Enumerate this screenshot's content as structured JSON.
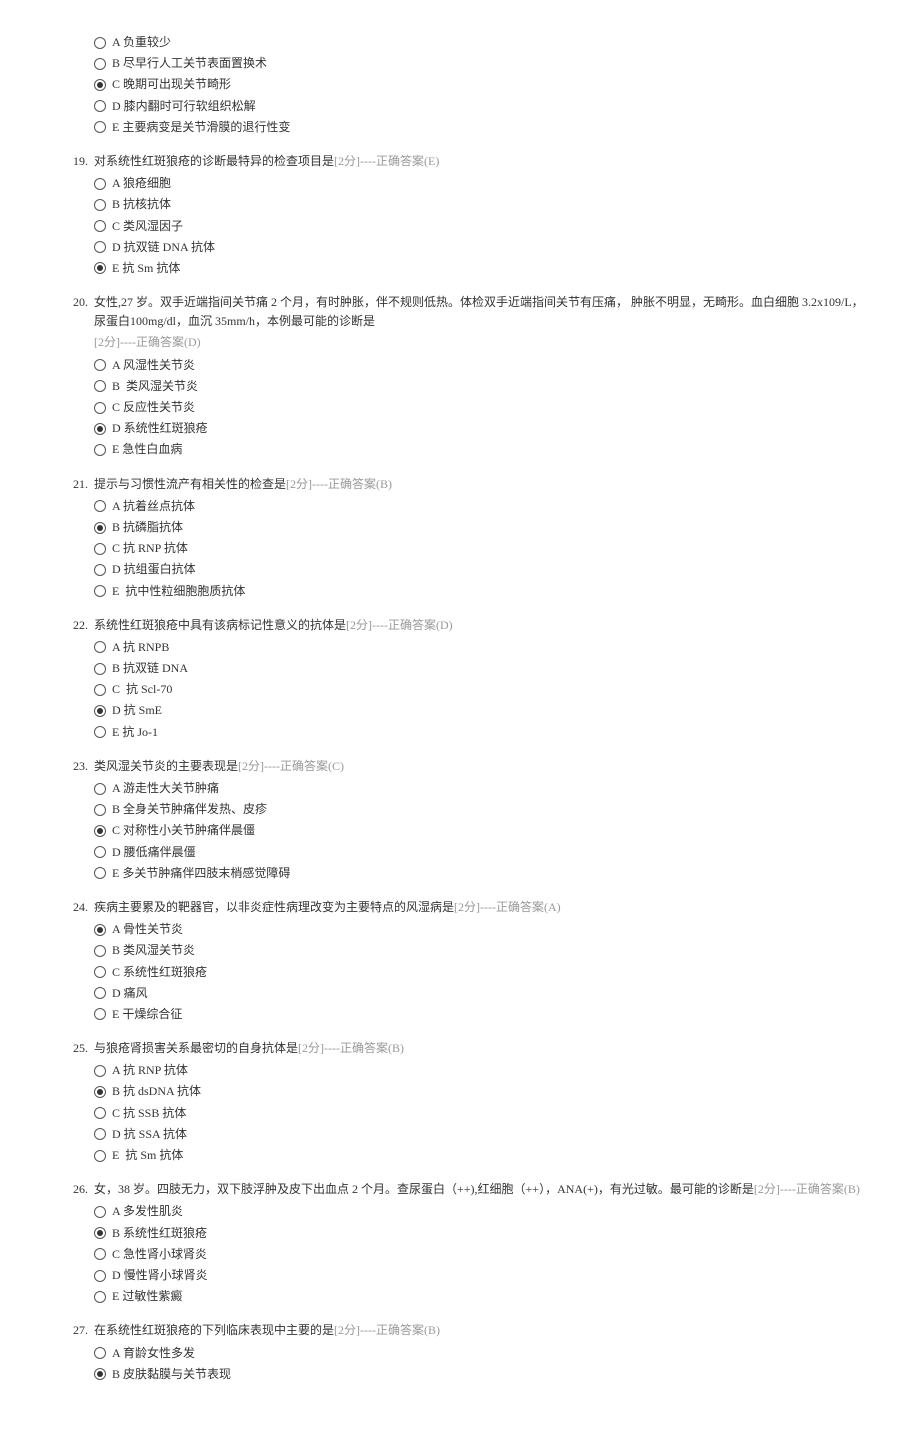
{
  "questions": [
    {
      "number": "",
      "stem": "",
      "meta": "",
      "options": [
        {
          "key": "A",
          "text": "负重较少",
          "selected": false
        },
        {
          "key": "B",
          "text": "尽早行人工关节表面置换术",
          "selected": false
        },
        {
          "key": "C",
          "text": "晚期可出现关节畸形",
          "selected": true
        },
        {
          "key": "D",
          "text": "膝内翻时可行软组织松解",
          "selected": false
        },
        {
          "key": "E",
          "text": "主要病变是关节滑膜的退行性变",
          "selected": false
        }
      ]
    },
    {
      "number": "19.",
      "stem": "对系统性红斑狼疮的诊断最特异的检查项目是",
      "meta": "[2分]----正确答案(E)",
      "options": [
        {
          "key": "A",
          "text": "狼疮细胞",
          "selected": false
        },
        {
          "key": "B",
          "text": "抗核抗体",
          "selected": false
        },
        {
          "key": "C",
          "text": "类风湿因子",
          "selected": false
        },
        {
          "key": "D",
          "text": "抗双链 DNA 抗体",
          "selected": false
        },
        {
          "key": "E",
          "text": "抗 Sm 抗体",
          "selected": true
        }
      ]
    },
    {
      "number": "20.",
      "stem": "女性,27 岁。双手近端指间关节痛 2 个月，有时肿胀，伴不规则低热。体检双手近端指间关节有压痛，  肿胀不明显，无畸形。血白细胞 3.2x109/L，尿蛋白100mg/dl，血沉 35mm/h，本例最可能的诊断是",
      "meta": "",
      "meta_line2": "[2分]----正确答案(D)",
      "options": [
        {
          "key": "A",
          "text": "风湿性关节炎",
          "selected": false
        },
        {
          "key": "B",
          "text": " 类风湿关节炎",
          "selected": false
        },
        {
          "key": "C",
          "text": "反应性关节炎",
          "selected": false
        },
        {
          "key": "D",
          "text": "系统性红斑狼疮",
          "selected": true
        },
        {
          "key": "E",
          "text": "急性白血病",
          "selected": false
        }
      ]
    },
    {
      "number": "21.",
      "stem": "提示与习惯性流产有相关性的检查是",
      "meta": "[2分]----正确答案(B)",
      "options": [
        {
          "key": "A",
          "text": "抗着丝点抗体",
          "selected": false
        },
        {
          "key": "B",
          "text": "抗磷脂抗体",
          "selected": true
        },
        {
          "key": "C",
          "text": "抗 RNP 抗体",
          "selected": false
        },
        {
          "key": "D",
          "text": "抗组蛋白抗体",
          "selected": false
        },
        {
          "key": "E",
          "text": " 抗中性粒细胞胞质抗体",
          "selected": false
        }
      ]
    },
    {
      "number": "22.",
      "stem": "系统性红斑狼疮中具有该病标记性意义的抗体是",
      "meta": "[2分]----正确答案(D)",
      "options": [
        {
          "key": "A",
          "text": "抗 RNPB",
          "selected": false
        },
        {
          "key": "B",
          "text": "抗双链 DNA",
          "selected": false
        },
        {
          "key": "C",
          "text": " 抗 Scl-70",
          "selected": false
        },
        {
          "key": "D",
          "text": "抗 SmE",
          "selected": true
        },
        {
          "key": "E",
          "text": "抗 Jo-1",
          "selected": false
        }
      ]
    },
    {
      "number": "23.",
      "stem": "类风湿关节炎的主要表现是",
      "meta": "[2分]----正确答案(C)",
      "options": [
        {
          "key": "A",
          "text": "游走性大关节肿痛",
          "selected": false
        },
        {
          "key": "B",
          "text": "全身关节肿痛伴发热、皮疹",
          "selected": false
        },
        {
          "key": "C",
          "text": "对称性小关节肿痛伴晨僵",
          "selected": true
        },
        {
          "key": "D",
          "text": "腰低痛伴晨僵",
          "selected": false
        },
        {
          "key": "E",
          "text": "多关节肿痛伴四肢末梢感觉障碍",
          "selected": false
        }
      ]
    },
    {
      "number": "24.",
      "stem": "疾病主要累及的靶器官，以非炎症性病理改变为主要特点的风湿病是",
      "meta": "[2分]----正确答案(A)",
      "options": [
        {
          "key": "A",
          "text": "骨性关节炎",
          "selected": true
        },
        {
          "key": "B",
          "text": "类风湿关节炎",
          "selected": false
        },
        {
          "key": "C",
          "text": "系统性红斑狼疮",
          "selected": false
        },
        {
          "key": "D",
          "text": "痛风",
          "selected": false
        },
        {
          "key": "E",
          "text": "干燥综合征",
          "selected": false
        }
      ]
    },
    {
      "number": "25.",
      "stem": "与狼疮肾损害关系最密切的自身抗体是",
      "meta": "[2分]----正确答案(B)",
      "options": [
        {
          "key": "A",
          "text": "抗 RNP 抗体",
          "selected": false
        },
        {
          "key": "B",
          "text": "抗 dsDNA 抗体",
          "selected": true
        },
        {
          "key": "C",
          "text": "抗 SSB 抗体",
          "selected": false
        },
        {
          "key": "D",
          "text": "抗 SSA 抗体",
          "selected": false
        },
        {
          "key": "E",
          "text": " 抗 Sm 抗体",
          "selected": false
        }
      ]
    },
    {
      "number": "26.",
      "stem": "女，38 岁。四肢无力，双下肢浮肿及皮下出血点 2 个月。查尿蛋白（++),红细胞（++），ANA(+)，有光过敏。最可能的诊断是",
      "meta": "[2分]----正确答案(B)",
      "options": [
        {
          "key": "A",
          "text": "多发性肌炎",
          "selected": false
        },
        {
          "key": "B",
          "text": "系统性红斑狼疮",
          "selected": true
        },
        {
          "key": "C",
          "text": "急性肾小球肾炎",
          "selected": false
        },
        {
          "key": "D",
          "text": "慢性肾小球肾炎",
          "selected": false
        },
        {
          "key": "E",
          "text": "过敏性紫癜",
          "selected": false
        }
      ]
    },
    {
      "number": "27.",
      "stem": "在系统性红斑狼疮的下列临床表现中主要的是",
      "meta": "[2分]----正确答案(B)",
      "options": [
        {
          "key": "A",
          "text": "育龄女性多发",
          "selected": false
        },
        {
          "key": "B",
          "text": "皮肤黏膜与关节表现",
          "selected": true
        }
      ]
    }
  ]
}
